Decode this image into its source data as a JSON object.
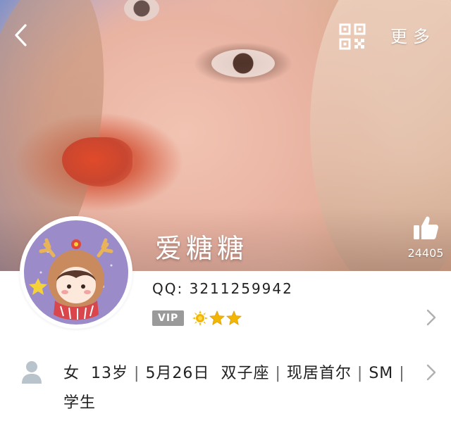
{
  "header": {
    "back_icon": "chevron-left-icon",
    "qr_icon": "qr-code-icon",
    "more_label": "更多"
  },
  "profile": {
    "nickname": "爱糖糖",
    "like_count": "24405",
    "qq_label": "QQ:",
    "qq_number": "3211259942",
    "vip_label": "VIP",
    "level_icons": [
      "sun-icon",
      "star-icon",
      "star-icon"
    ]
  },
  "details": {
    "gender": "女",
    "age": "13岁",
    "birthday": "5月26日",
    "zodiac": "双子座",
    "location": "现居首尔",
    "company": "SM",
    "occupation": "学生"
  },
  "colors": {
    "vip_badge": "#9a9a9a",
    "level_gold": "#f2b705",
    "icon_gray": "#b9c3cc"
  }
}
